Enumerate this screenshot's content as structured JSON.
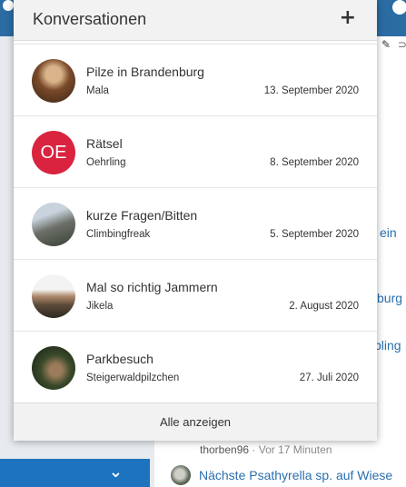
{
  "dropdown": {
    "title": "Konversationen",
    "add_icon": "plus-icon",
    "footer_label": "Alle anzeigen",
    "conversations": [
      {
        "title": "Pilze in Brandenburg",
        "user": "Mala",
        "date": "13. September 2020",
        "avatar": "photo"
      },
      {
        "title": "Rätsel",
        "user": "Oehrling",
        "date": "8. September 2020",
        "avatar_initials": "OE",
        "avatar_color": "#d9233f"
      },
      {
        "title": "kurze Fragen/Bitten",
        "user": "Climbingfreak",
        "date": "5. September 2020",
        "avatar": "photo"
      },
      {
        "title": "Mal so richtig Jammern",
        "user": "Jikela",
        "date": "2. August 2020",
        "avatar": "photo"
      },
      {
        "title": "Parkbesuch",
        "user": "Steigerwaldpilzchen",
        "date": "27. Juli 2020",
        "avatar": "photo"
      }
    ]
  },
  "background": {
    "link_fragments": [
      "ein",
      "burg",
      "bling"
    ],
    "post_meta_user": "thorben96",
    "post_meta_time": "· Vor 17 Minuten",
    "post_link": "Nächste Psathyrella sp. auf Wiese",
    "toolbar_icons": [
      "edit-icon",
      "rss-icon"
    ],
    "accent_color": "#1e73be"
  }
}
